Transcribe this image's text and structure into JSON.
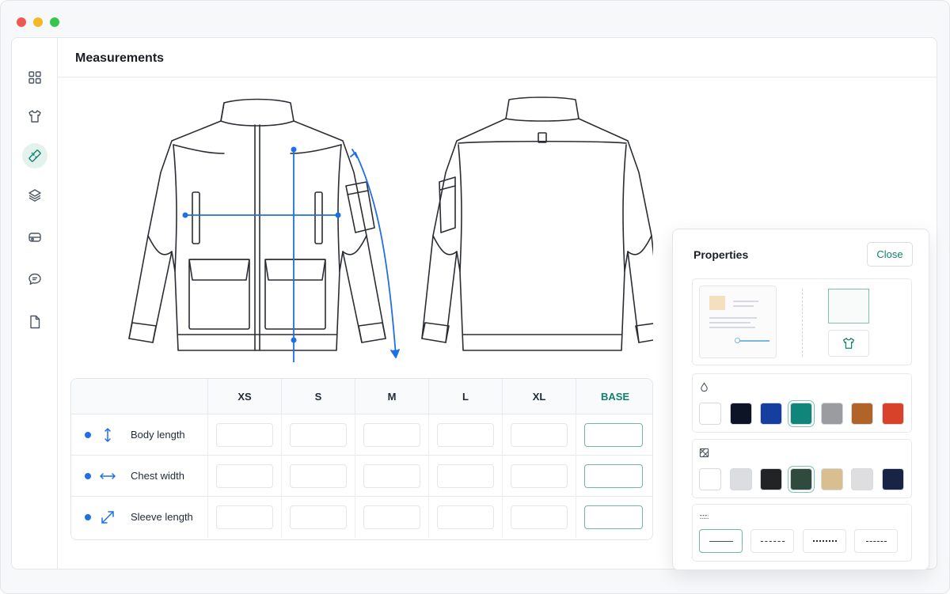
{
  "page": {
    "title": "Measurements"
  },
  "sidebar": {
    "items": [
      {
        "icon": "grid-icon"
      },
      {
        "icon": "tshirt-icon"
      },
      {
        "icon": "ruler-icon",
        "active": true
      },
      {
        "icon": "layers-icon"
      },
      {
        "icon": "fabric-roll-icon"
      },
      {
        "icon": "comment-icon"
      },
      {
        "icon": "document-icon"
      }
    ]
  },
  "table": {
    "columns": [
      "XS",
      "S",
      "M",
      "L",
      "XL",
      "BASE"
    ],
    "rows": [
      {
        "label": "Body length",
        "icon": "vertical-arrow-icon"
      },
      {
        "label": "Chest width",
        "icon": "horizontal-arrow-icon"
      },
      {
        "label": "Sleeve length",
        "icon": "diagonal-arrow-icon"
      }
    ]
  },
  "properties": {
    "title": "Properties",
    "close_label": "Close",
    "colors": [
      {
        "hex": "#ffffff",
        "selected": false
      },
      {
        "hex": "#0c1426",
        "selected": false
      },
      {
        "hex": "#153f9e",
        "selected": false
      },
      {
        "hex": "#0f8679",
        "selected": true
      },
      {
        "hex": "#9a9c9f",
        "selected": false
      },
      {
        "hex": "#b0642a",
        "selected": false
      },
      {
        "hex": "#d9422a",
        "selected": false
      }
    ],
    "textures": [
      {
        "hex": "#ffffff",
        "selected": false
      },
      {
        "hex": "#dcdde0",
        "selected": false
      },
      {
        "hex": "#222324",
        "selected": false
      },
      {
        "hex": "#2e4b3d",
        "selected": true
      },
      {
        "hex": "#d9bf90",
        "selected": false
      },
      {
        "hex": "#dededf",
        "selected": false
      },
      {
        "hex": "#182446",
        "selected": false
      }
    ],
    "line_styles": [
      {
        "style": "solid",
        "selected": true
      },
      {
        "style": "dashed",
        "selected": false
      },
      {
        "style": "dotted",
        "selected": false
      },
      {
        "style": "dash-dot",
        "selected": false
      }
    ]
  },
  "colors": {
    "accent": "#12806d",
    "measure": "#1f6fe5"
  }
}
